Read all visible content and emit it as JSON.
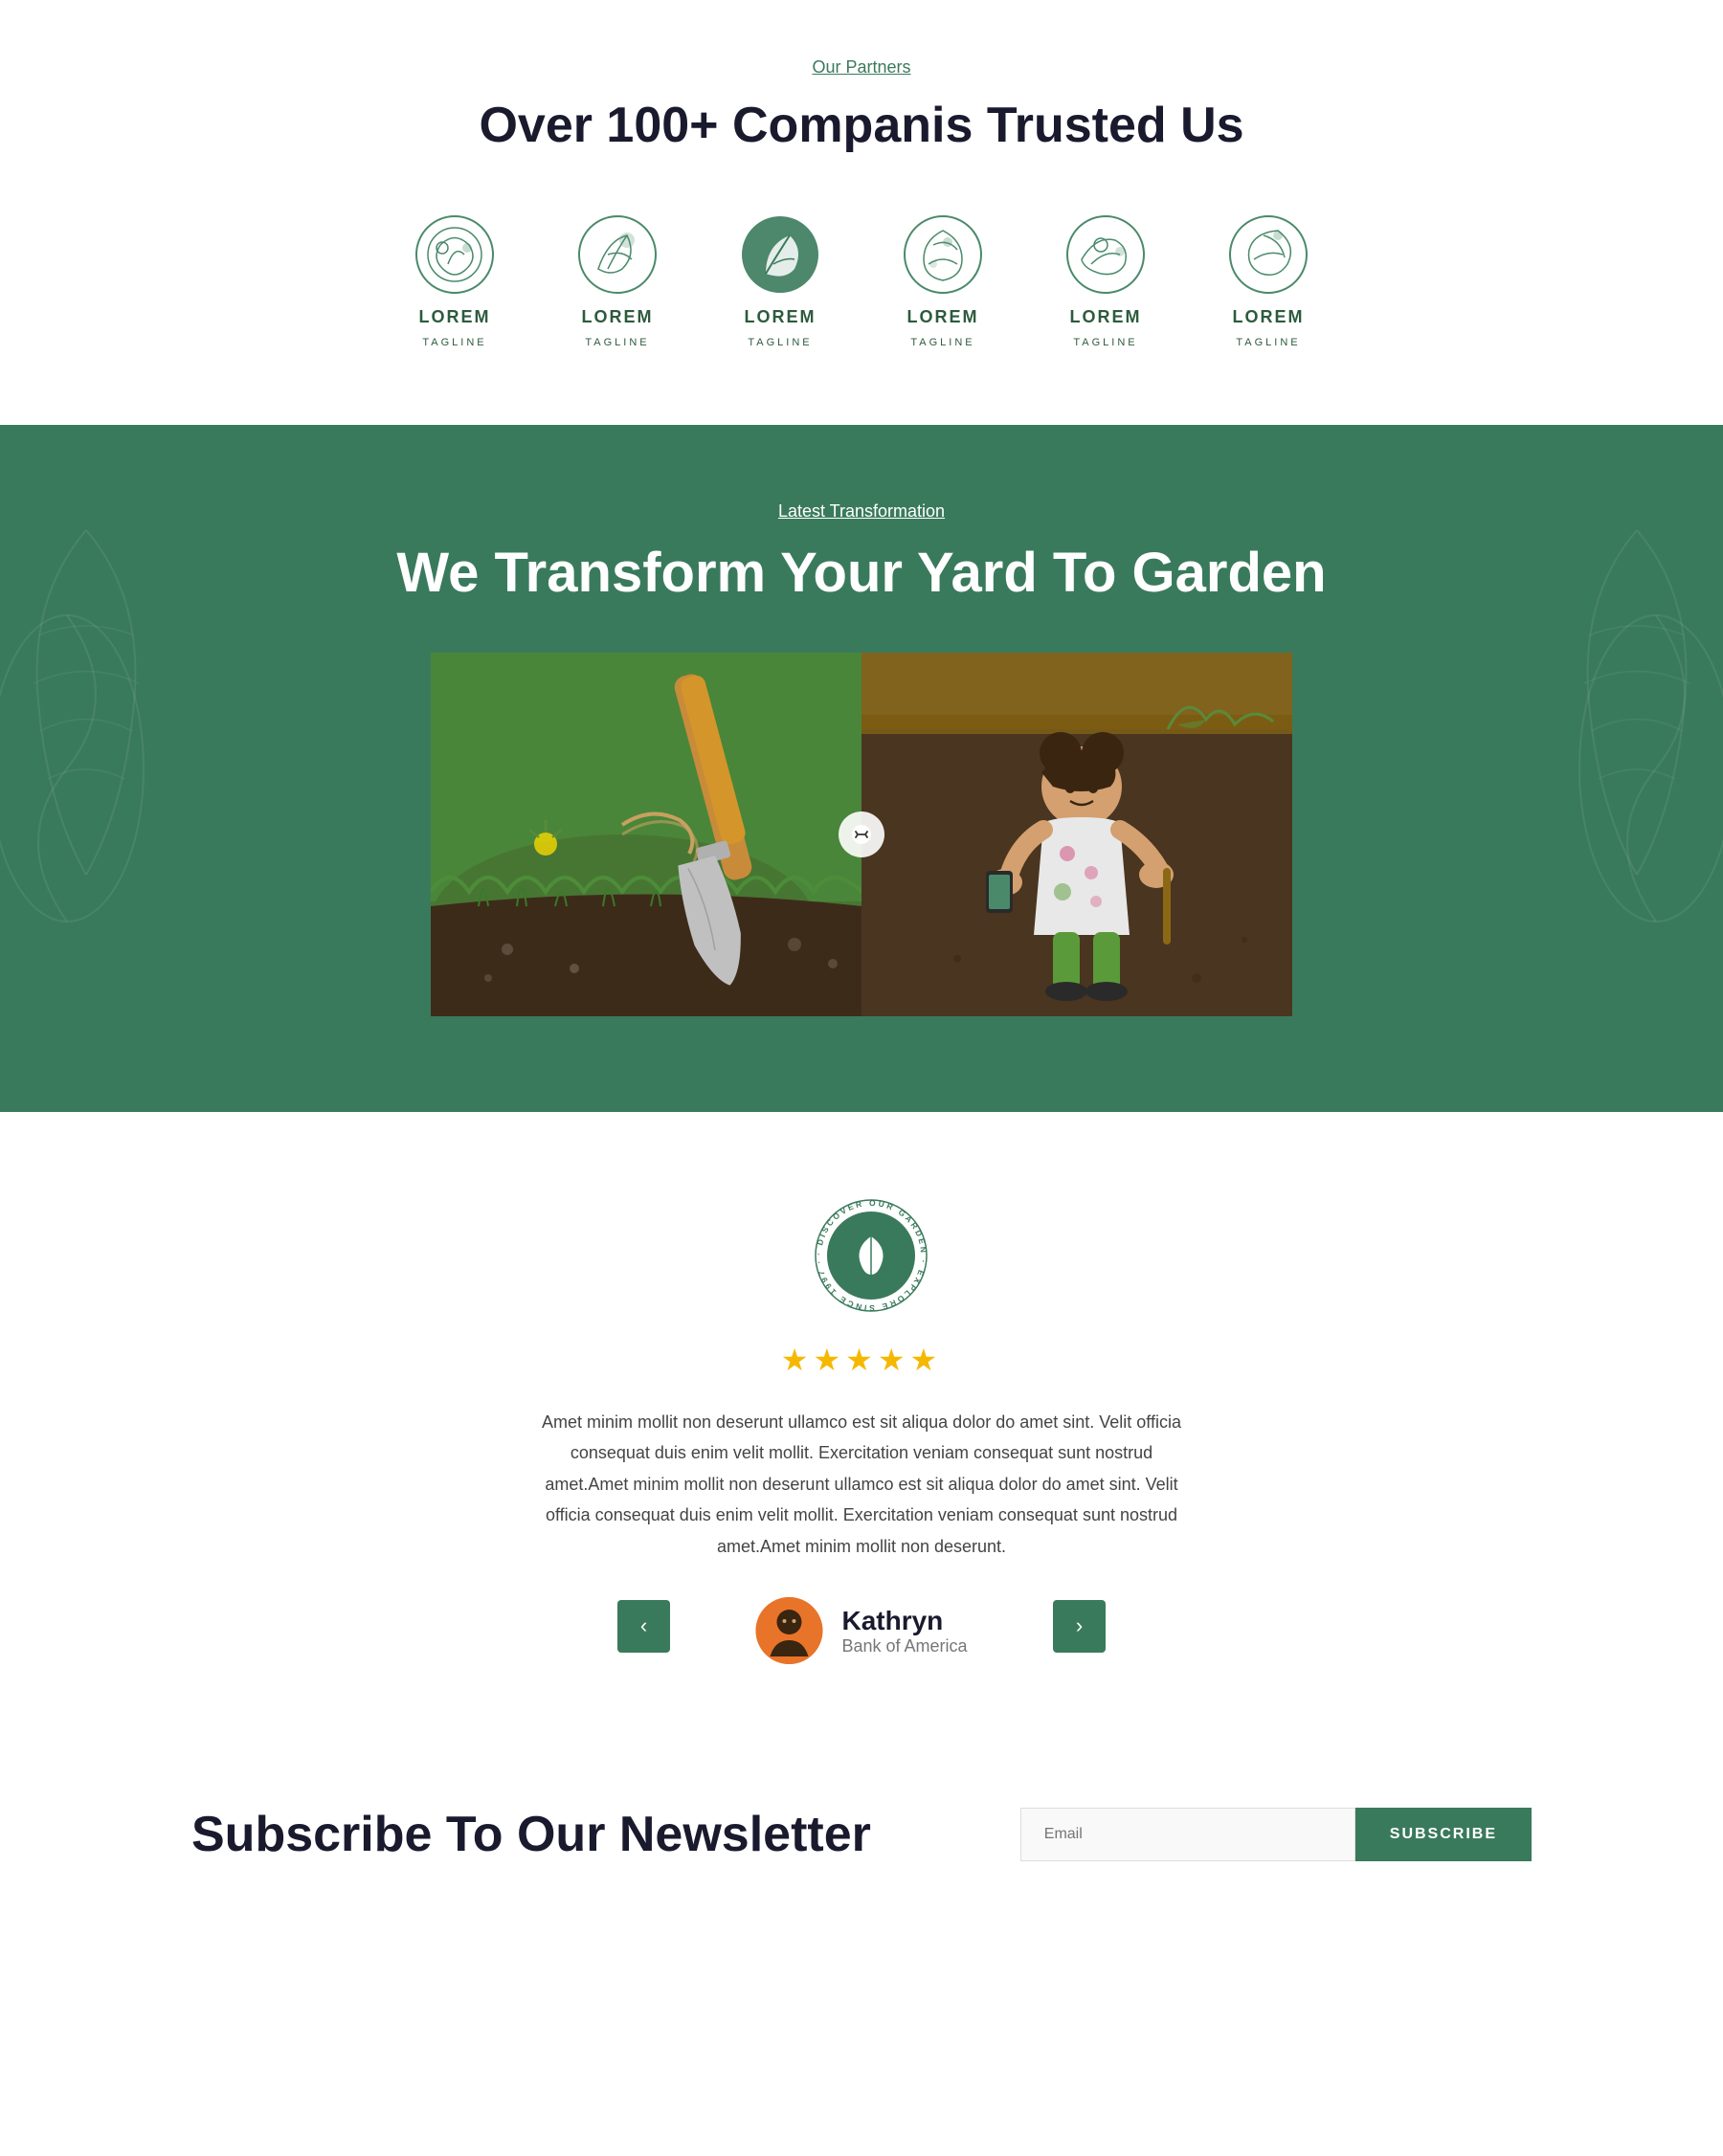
{
  "partners": {
    "label": "Our Partners",
    "title": "Over 100+ Companis Trusted Us",
    "logos": [
      {
        "name": "LOREM",
        "tagline": "TAGLINE"
      },
      {
        "name": "LOREM",
        "tagline": "TAGLINE"
      },
      {
        "name": "LOREM",
        "tagline": "TAGLINE"
      },
      {
        "name": "LOREM",
        "tagline": "TAGLINE"
      },
      {
        "name": "LOREM",
        "tagline": "TAGLINE"
      },
      {
        "name": "LOREM",
        "tagline": "TAGLINE"
      }
    ]
  },
  "transformation": {
    "label": "Latest Transformation",
    "title": "We Transform Your Yard To Garden"
  },
  "badge": {
    "text": "DISCOVER OUR GARDEN · EXPLORE SINCE 1997 ·"
  },
  "testimonial": {
    "stars": "★★★★★",
    "text": "Amet minim mollit non deserunt ullamco est sit aliqua dolor do amet sint. Velit officia consequat duis enim velit mollit. Exercitation veniam consequat sunt nostrud amet.Amet minim mollit non deserunt ullamco est sit aliqua dolor do amet sint. Velit officia consequat duis enim velit mollit. Exercitation veniam consequat sunt nostrud amet.Amet minim mollit non deserunt.",
    "author_name": "Kathryn",
    "author_company": "Bank of America",
    "prev_label": "‹",
    "next_label": "›"
  },
  "newsletter": {
    "title": "Subscribe To Our Newsletter",
    "input_placeholder": "Email",
    "button_label": "SUBSCRIBE"
  }
}
